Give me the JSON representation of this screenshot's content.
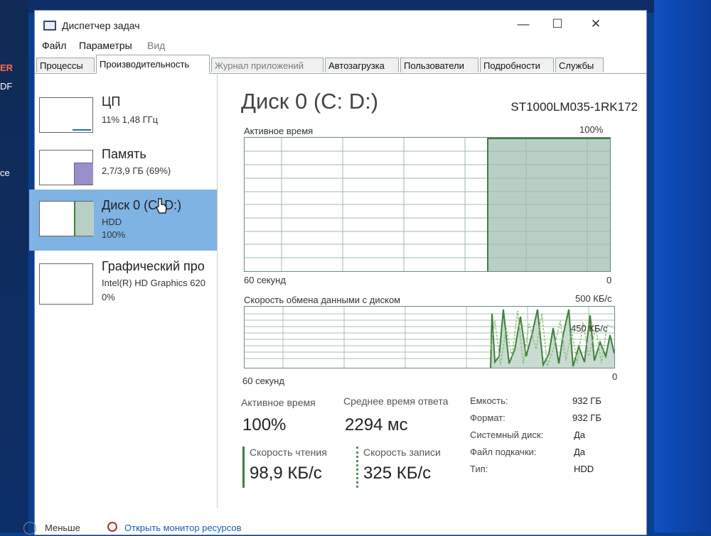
{
  "desktop": {
    "icon_texts": [
      "ER",
      "DF",
      "ce"
    ]
  },
  "window": {
    "title": "Диспетчер задач",
    "controls": {
      "minimize": "—",
      "maximize": "☐",
      "close": "✕"
    }
  },
  "menu": {
    "file": "Файл",
    "params": "Параметры",
    "view": "Вид"
  },
  "tabs": [
    {
      "label": "Процессы"
    },
    {
      "label": "Производительность"
    },
    {
      "label": "Журнал приложений"
    },
    {
      "label": "Автозагрузка"
    },
    {
      "label": "Пользователи"
    },
    {
      "label": "Подробности"
    },
    {
      "label": "Службы"
    }
  ],
  "sidebar": {
    "items": [
      {
        "name": "ЦП",
        "line1": "11% 1,48 ГГц",
        "line2": ""
      },
      {
        "name": "Память",
        "line1": "2,7/3,9 ГБ (69%)",
        "line2": ""
      },
      {
        "name": "Диск 0 (C: D:)",
        "line1": "HDD",
        "line2": "100%"
      },
      {
        "name": "Графический про",
        "line1": "Intel(R) HD Graphics 620",
        "line2": "0%"
      }
    ]
  },
  "disk": {
    "title": "Диск 0 (C: D:)",
    "model": "ST1000LM035-1RK172",
    "active_graph": {
      "label": "Активное время",
      "max": "100%",
      "time": "60 секунд",
      "min": "0"
    },
    "transfer_graph": {
      "label": "Скорость обмена данными с диском",
      "max": "500 КБ/с",
      "marker": "450 КБ/с",
      "time": "60 секунд",
      "min": "0"
    },
    "stats": {
      "active_time_label": "Активное время",
      "active_time_value": "100%",
      "response_label": "Среднее время ответа",
      "response_value": "2294 мс",
      "read_label": "Скорость чтения",
      "read_value": "98,9 КБ/с",
      "write_label": "Скорость записи",
      "write_value": "325 КБ/с"
    },
    "props": [
      {
        "k": "Емкость:",
        "v": "932 ГБ"
      },
      {
        "k": "Формат:",
        "v": "932 ГБ"
      },
      {
        "k": "Системный диск:",
        "v": "Да"
      },
      {
        "k": "Файл подкачки:",
        "v": "Да"
      },
      {
        "k": "Тип:",
        "v": "HDD"
      }
    ]
  },
  "footer": {
    "less": "Меньше",
    "monitor": "Открыть монитор ресурсов"
  },
  "colors": {
    "accent_selected": "#7fb3e4",
    "disk_fill": "#b8cfc6",
    "disk_line": "#3f7f3a"
  }
}
